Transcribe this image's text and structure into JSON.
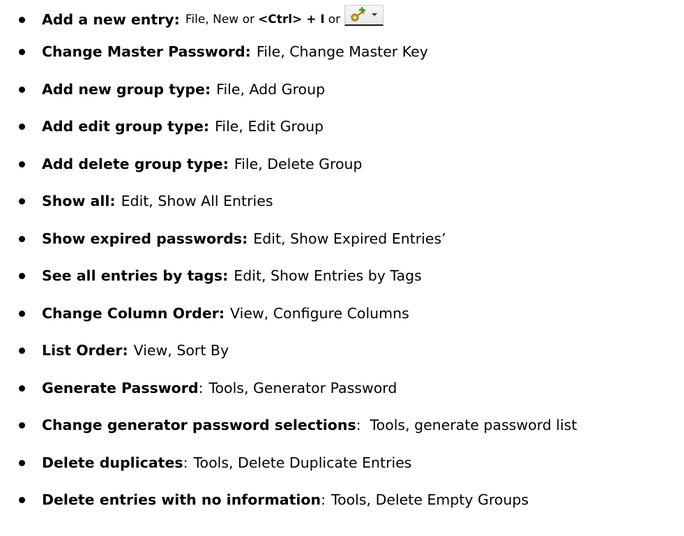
{
  "items": [
    {
      "term": "Add a new entry:",
      "desc_prefix": "File, New or",
      "key": "<Ctrl> + I",
      "desc_suffix": "or",
      "icon": "add-entry-key-icon"
    },
    {
      "term": "Change Master Password:",
      "desc": "File, Change Master Key"
    },
    {
      "term": "Add new group type:",
      "desc": "File, Add Group"
    },
    {
      "term": "Add edit group type:",
      "desc": "File, Edit Group"
    },
    {
      "term": "Add delete group type:",
      "desc": "File, Delete Group"
    },
    {
      "term": "Show all:",
      "desc": "Edit, Show All Entries"
    },
    {
      "term": "Show expired passwords:",
      "desc": "Edit, Show Expired Entries’"
    },
    {
      "term": "See all entries by tags:",
      "desc": "Edit, Show Entries by Tags"
    },
    {
      "term": "Change Column Order:",
      "desc": "View, Configure Columns"
    },
    {
      "term": "List Order:",
      "desc": "View, Sort By"
    },
    {
      "term": "Generate Password",
      "sep": ":",
      "desc": "Tools, Generator Password"
    },
    {
      "term": "Change generator password selections",
      "sep": ":",
      "desc": "Tools, generate password list"
    },
    {
      "term": "Delete duplicates",
      "sep": ":",
      "desc": "Tools, Delete Duplicate Entries"
    },
    {
      "term": "Delete entries with no information",
      "sep": ":",
      "desc": "Tools, Delete Empty Groups"
    }
  ],
  "colors": {
    "text": "#000000",
    "background": "#ffffff",
    "key_icon_gold": "#d4a017",
    "key_icon_green": "#3a9a2a"
  }
}
